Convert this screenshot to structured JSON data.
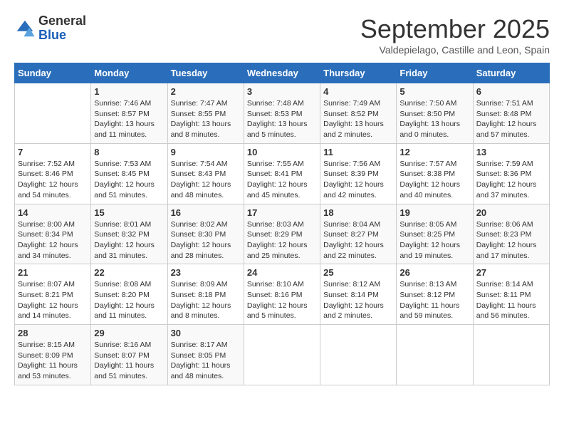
{
  "app": {
    "logo_general": "General",
    "logo_blue": "Blue"
  },
  "header": {
    "month_title": "September 2025",
    "location": "Valdepielago, Castille and Leon, Spain"
  },
  "columns": [
    "Sunday",
    "Monday",
    "Tuesday",
    "Wednesday",
    "Thursday",
    "Friday",
    "Saturday"
  ],
  "weeks": [
    [
      {
        "day": "",
        "info": ""
      },
      {
        "day": "1",
        "info": "Sunrise: 7:46 AM\nSunset: 8:57 PM\nDaylight: 13 hours\nand 11 minutes."
      },
      {
        "day": "2",
        "info": "Sunrise: 7:47 AM\nSunset: 8:55 PM\nDaylight: 13 hours\nand 8 minutes."
      },
      {
        "day": "3",
        "info": "Sunrise: 7:48 AM\nSunset: 8:53 PM\nDaylight: 13 hours\nand 5 minutes."
      },
      {
        "day": "4",
        "info": "Sunrise: 7:49 AM\nSunset: 8:52 PM\nDaylight: 13 hours\nand 2 minutes."
      },
      {
        "day": "5",
        "info": "Sunrise: 7:50 AM\nSunset: 8:50 PM\nDaylight: 13 hours\nand 0 minutes."
      },
      {
        "day": "6",
        "info": "Sunrise: 7:51 AM\nSunset: 8:48 PM\nDaylight: 12 hours\nand 57 minutes."
      }
    ],
    [
      {
        "day": "7",
        "info": "Sunrise: 7:52 AM\nSunset: 8:46 PM\nDaylight: 12 hours\nand 54 minutes."
      },
      {
        "day": "8",
        "info": "Sunrise: 7:53 AM\nSunset: 8:45 PM\nDaylight: 12 hours\nand 51 minutes."
      },
      {
        "day": "9",
        "info": "Sunrise: 7:54 AM\nSunset: 8:43 PM\nDaylight: 12 hours\nand 48 minutes."
      },
      {
        "day": "10",
        "info": "Sunrise: 7:55 AM\nSunset: 8:41 PM\nDaylight: 12 hours\nand 45 minutes."
      },
      {
        "day": "11",
        "info": "Sunrise: 7:56 AM\nSunset: 8:39 PM\nDaylight: 12 hours\nand 42 minutes."
      },
      {
        "day": "12",
        "info": "Sunrise: 7:57 AM\nSunset: 8:38 PM\nDaylight: 12 hours\nand 40 minutes."
      },
      {
        "day": "13",
        "info": "Sunrise: 7:59 AM\nSunset: 8:36 PM\nDaylight: 12 hours\nand 37 minutes."
      }
    ],
    [
      {
        "day": "14",
        "info": "Sunrise: 8:00 AM\nSunset: 8:34 PM\nDaylight: 12 hours\nand 34 minutes."
      },
      {
        "day": "15",
        "info": "Sunrise: 8:01 AM\nSunset: 8:32 PM\nDaylight: 12 hours\nand 31 minutes."
      },
      {
        "day": "16",
        "info": "Sunrise: 8:02 AM\nSunset: 8:30 PM\nDaylight: 12 hours\nand 28 minutes."
      },
      {
        "day": "17",
        "info": "Sunrise: 8:03 AM\nSunset: 8:29 PM\nDaylight: 12 hours\nand 25 minutes."
      },
      {
        "day": "18",
        "info": "Sunrise: 8:04 AM\nSunset: 8:27 PM\nDaylight: 12 hours\nand 22 minutes."
      },
      {
        "day": "19",
        "info": "Sunrise: 8:05 AM\nSunset: 8:25 PM\nDaylight: 12 hours\nand 19 minutes."
      },
      {
        "day": "20",
        "info": "Sunrise: 8:06 AM\nSunset: 8:23 PM\nDaylight: 12 hours\nand 17 minutes."
      }
    ],
    [
      {
        "day": "21",
        "info": "Sunrise: 8:07 AM\nSunset: 8:21 PM\nDaylight: 12 hours\nand 14 minutes."
      },
      {
        "day": "22",
        "info": "Sunrise: 8:08 AM\nSunset: 8:20 PM\nDaylight: 12 hours\nand 11 minutes."
      },
      {
        "day": "23",
        "info": "Sunrise: 8:09 AM\nSunset: 8:18 PM\nDaylight: 12 hours\nand 8 minutes."
      },
      {
        "day": "24",
        "info": "Sunrise: 8:10 AM\nSunset: 8:16 PM\nDaylight: 12 hours\nand 5 minutes."
      },
      {
        "day": "25",
        "info": "Sunrise: 8:12 AM\nSunset: 8:14 PM\nDaylight: 12 hours\nand 2 minutes."
      },
      {
        "day": "26",
        "info": "Sunrise: 8:13 AM\nSunset: 8:12 PM\nDaylight: 11 hours\nand 59 minutes."
      },
      {
        "day": "27",
        "info": "Sunrise: 8:14 AM\nSunset: 8:11 PM\nDaylight: 11 hours\nand 56 minutes."
      }
    ],
    [
      {
        "day": "28",
        "info": "Sunrise: 8:15 AM\nSunset: 8:09 PM\nDaylight: 11 hours\nand 53 minutes."
      },
      {
        "day": "29",
        "info": "Sunrise: 8:16 AM\nSunset: 8:07 PM\nDaylight: 11 hours\nand 51 minutes."
      },
      {
        "day": "30",
        "info": "Sunrise: 8:17 AM\nSunset: 8:05 PM\nDaylight: 11 hours\nand 48 minutes."
      },
      {
        "day": "",
        "info": ""
      },
      {
        "day": "",
        "info": ""
      },
      {
        "day": "",
        "info": ""
      },
      {
        "day": "",
        "info": ""
      }
    ]
  ]
}
